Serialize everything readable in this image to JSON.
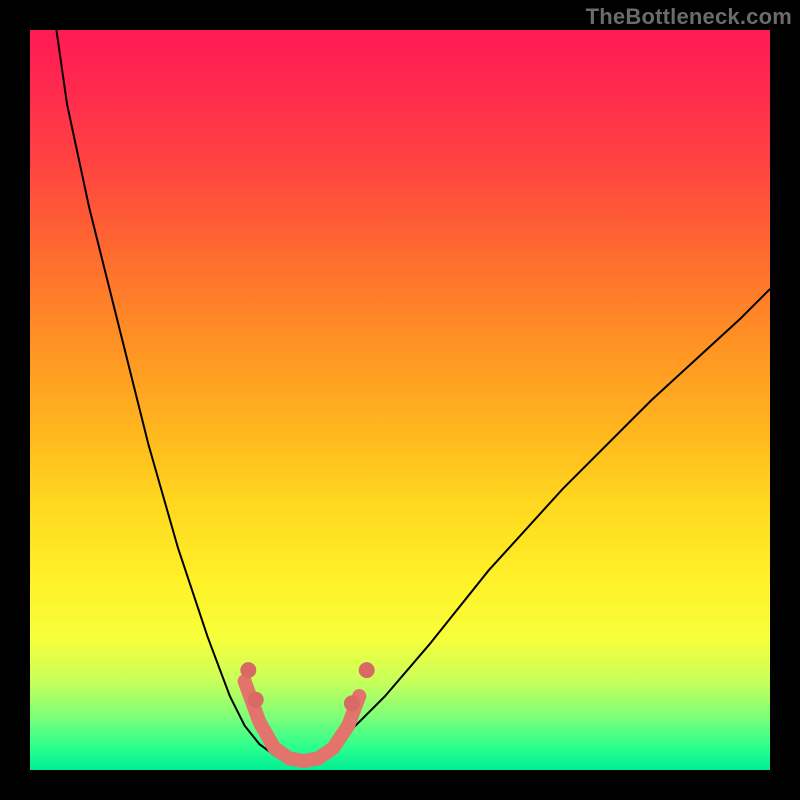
{
  "watermark": "TheBottleneck.com",
  "colors": {
    "gradient_top": "#ff1a55",
    "gradient_mid": "#ffd81f",
    "gradient_bottom": "#00ef94",
    "curve": "#000000",
    "segment": "#e2746c",
    "frame": "#000000"
  },
  "chart_data": {
    "type": "line",
    "title": "",
    "xlabel": "",
    "ylabel": "",
    "xlim": [
      0,
      100
    ],
    "ylim": [
      0,
      100
    ],
    "grid": false,
    "legend": false,
    "series": [
      {
        "name": "left-branch",
        "x": [
          3,
          5,
          8,
          12,
          16,
          20,
          24,
          27,
          29,
          31,
          33,
          34.5,
          36
        ],
        "y": [
          104,
          90,
          76,
          60,
          44,
          30,
          18,
          10,
          6,
          3.5,
          2,
          1.2,
          1
        ]
      },
      {
        "name": "right-branch",
        "x": [
          36,
          38,
          41,
          44,
          48,
          54,
          62,
          72,
          84,
          96,
          100
        ],
        "y": [
          1,
          1.5,
          3,
          6,
          10,
          17,
          27,
          38,
          50,
          61,
          65
        ]
      }
    ],
    "highlight_segment": {
      "name": "valley-marker",
      "x": [
        29,
        31,
        33,
        35,
        37,
        39,
        41,
        43,
        44.5
      ],
      "y": [
        12,
        6.5,
        3,
        1.6,
        1.2,
        1.6,
        3,
        6,
        10
      ]
    },
    "highlight_dots": {
      "x": [
        29.5,
        30.5,
        43.5,
        45.5
      ],
      "y": [
        13.5,
        9.5,
        9,
        13.5
      ]
    }
  }
}
